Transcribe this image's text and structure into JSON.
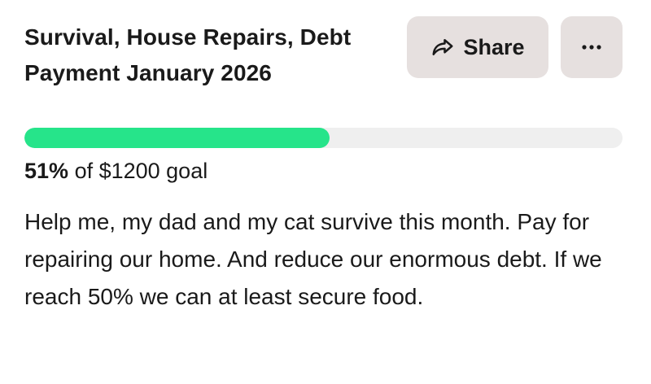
{
  "campaign": {
    "title": "Survival, House Repairs, Debt Payment January 2026",
    "progress_percent": 51,
    "progress_percent_label": "51%",
    "goal_text": "of $1200 goal",
    "description": "Help me, my dad and my cat survive this month. Pay for repairing our home. And reduce our enormous debt. If we reach 50% we can at least secure food."
  },
  "actions": {
    "share_label": "Share",
    "share_icon": "share-arrow-icon",
    "more_icon": "more-dots-icon"
  },
  "colors": {
    "progress_fill": "#26e48a",
    "progress_track": "#efefef",
    "button_bg": "#e6e0df",
    "text": "#1a1a1a"
  }
}
